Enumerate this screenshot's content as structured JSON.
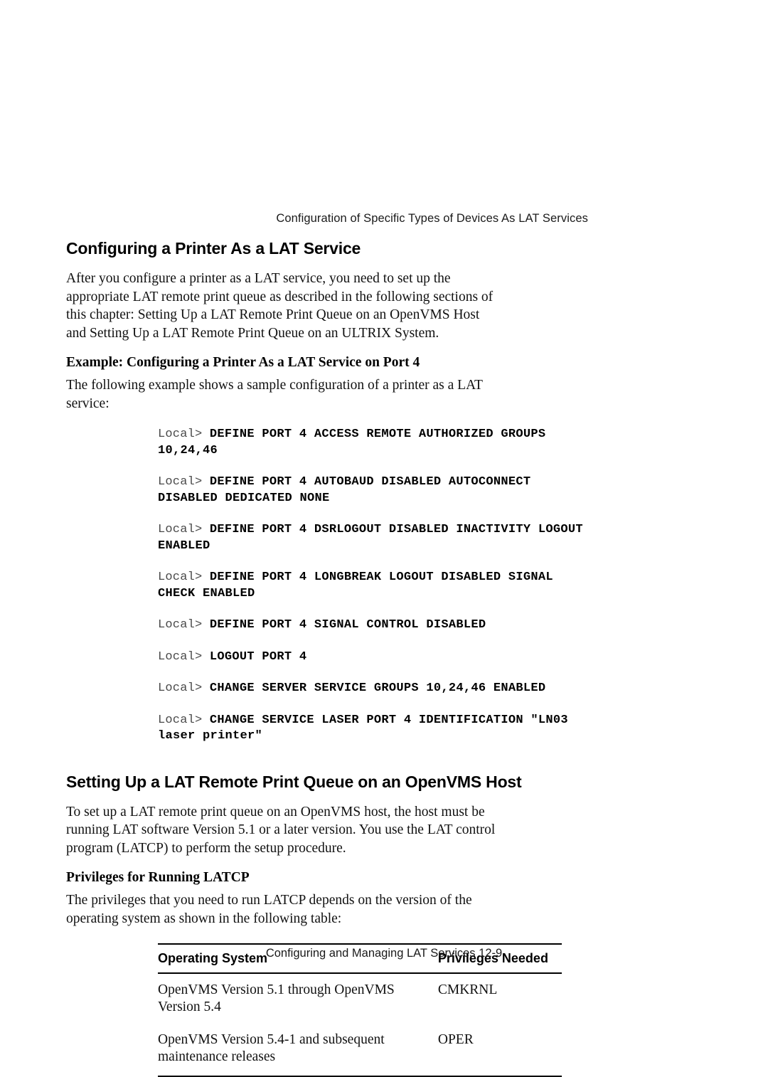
{
  "page": {
    "running_header": "Configuration of Specific Types of Devices As LAT Services",
    "footer": "Configuring and Managing LAT Services 12-9"
  },
  "sections": [
    {
      "title": "Configuring a Printer As a LAT Service",
      "paragraph": "After you configure a printer as a LAT service, you need to set up the appropriate LAT remote print queue as described in the following sections of this chapter:  Setting Up a LAT Remote Print Queue on an OpenVMS Host and Setting Up a LAT Remote Print Queue on an ULTRIX System.",
      "subtitle": "Example: Configuring a Printer As a LAT Service on Port 4",
      "sub_paragraph": "The following example shows a sample configuration of a printer as a LAT service:"
    },
    {
      "title": "Setting Up a LAT Remote Print Queue on an OpenVMS Host",
      "paragraph": "To set up a LAT remote print queue on an OpenVMS host, the host must be running LAT software Version 5.1 or a later version. You use the LAT control program (LATCP) to perform the setup procedure.",
      "subtitle": "Privileges for Running LATCP",
      "sub_paragraph": "The privileges that you need to run LATCP depends on the version of the operating system as shown in the following table:"
    }
  ],
  "code_block": {
    "prompt": "Local> ",
    "lines": [
      "DEFINE PORT 4 ACCESS REMOTE AUTHORIZED GROUPS 10,24,46",
      "DEFINE PORT 4 AUTOBAUD DISABLED AUTOCONNECT DISABLED DEDICATED NONE",
      "DEFINE PORT 4 DSRLOGOUT DISABLED INACTIVITY LOGOUT ENABLED",
      "DEFINE PORT 4 LONGBREAK LOGOUT DISABLED SIGNAL CHECK ENABLED",
      "DEFINE PORT 4 SIGNAL CONTROL DISABLED",
      "LOGOUT PORT 4",
      "CHANGE SERVER SERVICE GROUPS 10,24,46 ENABLED",
      "CHANGE SERVICE LASER PORT 4 IDENTIFICATION \"LN03 laser printer\""
    ]
  },
  "priv_table": {
    "headers": {
      "os": "Operating System",
      "priv": "Privileges Needed"
    },
    "rows": [
      {
        "os": "OpenVMS Version 5.1 through OpenVMS Version 5.4",
        "priv": "CMKRNL"
      },
      {
        "os": "OpenVMS Version 5.4-1 and subsequent maintenance releases",
        "priv": "OPER"
      }
    ]
  }
}
